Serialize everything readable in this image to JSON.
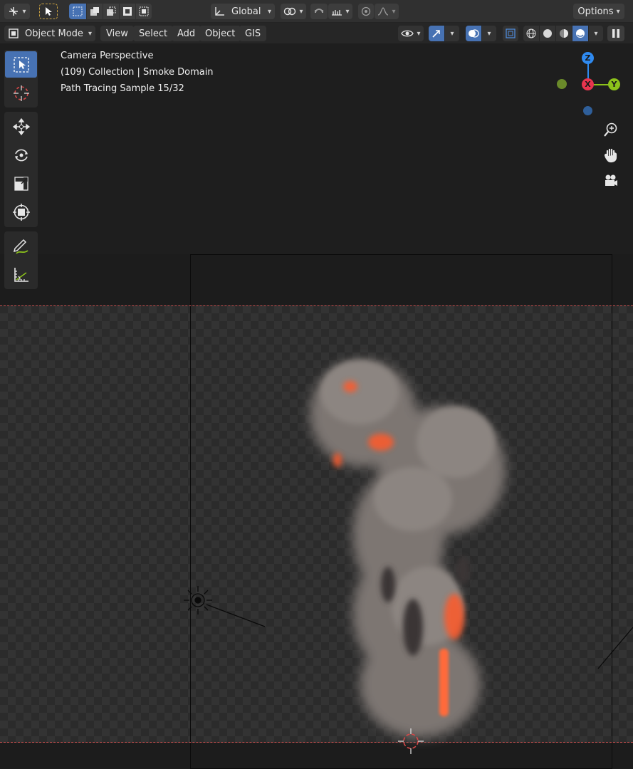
{
  "header": {
    "transform_orientation": "Global",
    "options_label": "Options"
  },
  "menubar": {
    "mode": "Object Mode",
    "items": [
      "View",
      "Select",
      "Add",
      "Object",
      "GIS"
    ]
  },
  "viewport": {
    "info_lines": [
      "Camera Perspective",
      "(109) Collection | Smoke Domain",
      "Path Tracing Sample 15/32"
    ]
  },
  "gizmo": {
    "x_label": "X",
    "y_label": "Y",
    "z_label": "Z",
    "colors": {
      "x": "#e8344e",
      "y": "#8cc21b",
      "z": "#2f8af0",
      "neg_y": "#6a8a2a",
      "neg_z": "#2f5f9a"
    }
  },
  "colors": {
    "accent": "#4772b3",
    "header_bg": "#303030",
    "viewport_bg": "#1e1e1e"
  },
  "icons": {
    "toolbar": [
      "select-box-icon",
      "cursor-icon",
      "move-icon",
      "rotate-icon",
      "scale-icon",
      "transform-icon",
      "annotate-icon",
      "measure-icon"
    ],
    "nav": [
      "zoom-icon",
      "pan-hand-icon",
      "camera-view-icon"
    ]
  }
}
